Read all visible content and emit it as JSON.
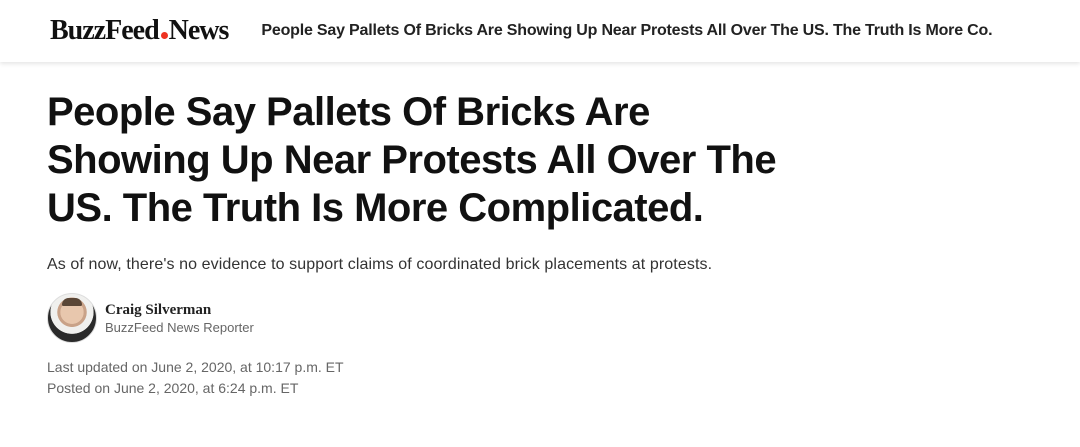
{
  "header": {
    "logo": {
      "buzz": "BuzzFeed",
      "news": "News",
      "dot_color": "#ee3322"
    },
    "sticky_title": "People Say Pallets Of Bricks Are Showing Up Near Protests All Over The US. The Truth Is More Co."
  },
  "article": {
    "headline": "People Say Pallets Of Bricks Are Showing Up Near Protests All Over The US. The Truth Is More Complicated.",
    "dek": "As of now, there's no evidence to support claims of coordinated brick placements at protests.",
    "author": {
      "name": "Craig Silverman",
      "role": "BuzzFeed News Reporter",
      "avatar_icon": "author-photo"
    },
    "last_updated": "Last updated on June 2, 2020, at 10:17 p.m. ET",
    "posted": "Posted on June 2, 2020, at 6:24 p.m. ET"
  }
}
